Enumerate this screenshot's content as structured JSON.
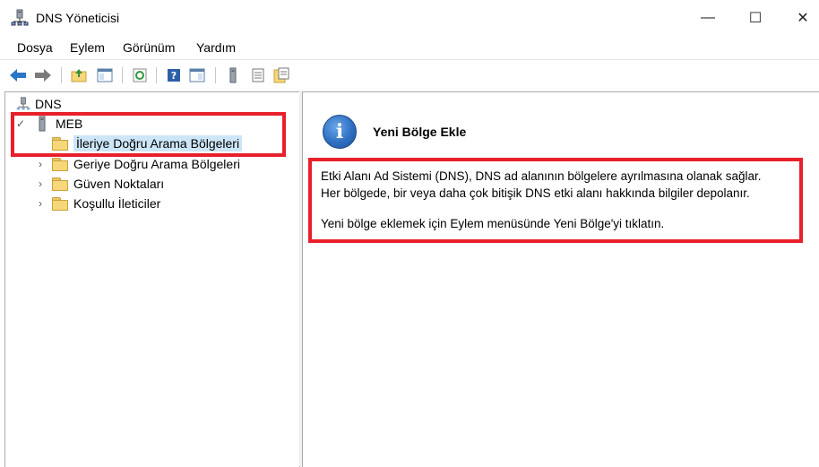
{
  "window": {
    "title": "DNS Yöneticisi",
    "minimize_glyph": "—",
    "maximize_glyph": "☐",
    "close_glyph": "✕"
  },
  "menu": [
    "Dosya",
    "Eylem",
    "Görünüm",
    "Yardım"
  ],
  "toolbar": {
    "icons": [
      "back-icon",
      "forward-icon",
      "up-folder-icon",
      "show-hide-tree-icon",
      "refresh-icon",
      "help-icon",
      "properties-icon",
      "server-icon",
      "list-icon",
      "export-icon"
    ]
  },
  "tree": {
    "root": "DNS",
    "server": "MEB",
    "children": [
      "İleriye Doğru Arama Bölgeleri",
      "Geriye Doğru Arama Bölgeleri",
      "Güven Noktaları",
      "Koşullu İleticiler"
    ]
  },
  "details": {
    "title": "Yeni Bölge Ekle",
    "lines": [
      "Etki Alanı Ad Sistemi (DNS), DNS ad alanının bölgelere ayrılmasına olanak sağlar.",
      "Her bölgede, bir veya daha çok bitişik DNS etki alanı hakkında bilgiler depolanır.",
      "Yeni bölge eklemek için Eylem menüsünde Yeni Bölge'yi tıklatın."
    ]
  },
  "colors": {
    "highlight_box": "#e8202b",
    "selection": "#cde6f7",
    "info_icon": "#2e6fc2"
  }
}
